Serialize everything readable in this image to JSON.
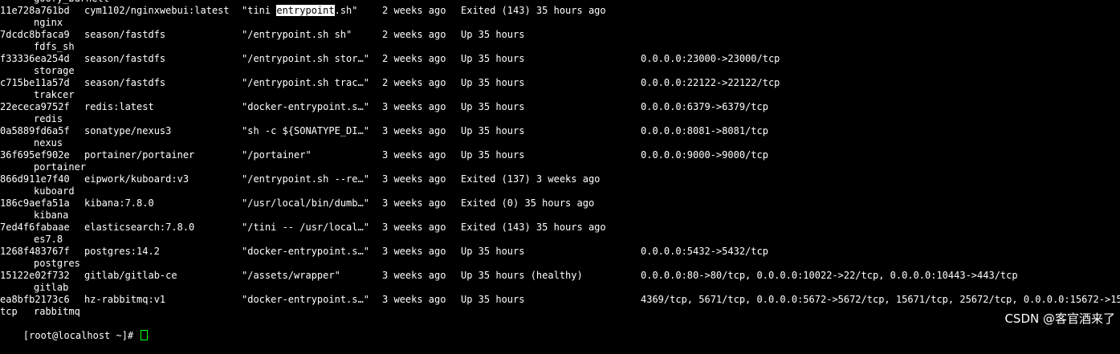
{
  "terminal": {
    "top_name": "goofy_burnett",
    "rows": [
      {
        "id": "11e728a761bd",
        "image": "cym1102/nginxwebui:latest",
        "cmd_before": "\"tini ",
        "cmd_highlight": "entrypoint",
        "cmd_after": ".sh\"",
        "created": "2 weeks ago",
        "status": "Exited (143) 35 hours ago",
        "ports": "",
        "name": "nginx"
      },
      {
        "id": "7dcdc8bfaca9",
        "image": "season/fastdfs",
        "cmd": "\"/entrypoint.sh sh\"",
        "created": "2 weeks ago",
        "status": "Up 35 hours",
        "ports": "",
        "name": "fdfs_sh"
      },
      {
        "id": "f33336ea254d",
        "image": "season/fastdfs",
        "cmd": "\"/entrypoint.sh stor…\"",
        "created": "2 weeks ago",
        "status": "Up 35 hours",
        "ports": "0.0.0.0:23000->23000/tcp",
        "name": "storage"
      },
      {
        "id": "c715be11a57d",
        "image": "season/fastdfs",
        "cmd": "\"/entrypoint.sh trac…\"",
        "created": "2 weeks ago",
        "status": "Up 35 hours",
        "ports": "0.0.0.0:22122->22122/tcp",
        "name": "trakcer"
      },
      {
        "id": "22ececa9752f",
        "image": "redis:latest",
        "cmd": "\"docker-entrypoint.s…\"",
        "created": "3 weeks ago",
        "status": "Up 35 hours",
        "ports": "0.0.0.0:6379->6379/tcp",
        "name": "redis"
      },
      {
        "id": "0a5889fd6a5f",
        "image": "sonatype/nexus3",
        "cmd": "\"sh -c ${SONATYPE_DI…\"",
        "created": "3 weeks ago",
        "status": "Up 35 hours",
        "ports": "0.0.0.0:8081->8081/tcp",
        "name": "nexus"
      },
      {
        "id": "36f695ef902e",
        "image": "portainer/portainer",
        "cmd": "\"/portainer\"",
        "created": "3 weeks ago",
        "status": "Up 35 hours",
        "ports": "0.0.0.0:9000->9000/tcp",
        "name": "portainer"
      },
      {
        "id": "866d911e7f40",
        "image": "eipwork/kuboard:v3",
        "cmd": "\"/entrypoint.sh --re…\"",
        "created": "3 weeks ago",
        "status": "Exited (137) 3 weeks ago",
        "ports": "",
        "name": "kuboard"
      },
      {
        "id": "186c9aefa51a",
        "image": "kibana:7.8.0",
        "cmd": "\"/usr/local/bin/dumb…\"",
        "created": "3 weeks ago",
        "status": "Exited (0) 35 hours ago",
        "ports": "",
        "name": "kibana"
      },
      {
        "id": "7ed4f6fabaae",
        "image": "elasticsearch:7.8.0",
        "cmd": "\"/tini -- /usr/local…\"",
        "created": "3 weeks ago",
        "status": "Exited (143) 35 hours ago",
        "ports": "",
        "name": "es7.8"
      },
      {
        "id": "1268f483767f",
        "image": "postgres:14.2",
        "cmd": "\"docker-entrypoint.s…\"",
        "created": "3 weeks ago",
        "status": "Up 35 hours",
        "ports": "0.0.0.0:5432->5432/tcp",
        "name": "postgres"
      },
      {
        "id": "15122e02f732",
        "image": "gitlab/gitlab-ce",
        "cmd": "\"/assets/wrapper\"",
        "created": "3 weeks ago",
        "status": "Up 35 hours (healthy)",
        "ports": "0.0.0.0:80->80/tcp, 0.0.0.0:10022->22/tcp, 0.0.0.0:10443->443/tcp",
        "name": "gitlab"
      },
      {
        "id": "ea8bfb2173c6",
        "image": "hz-rabbitmq:v1",
        "cmd": "\"docker-entrypoint.s…\"",
        "created": "3 weeks ago",
        "status": "Up 35 hours",
        "ports": "4369/tcp, 5671/tcp, 0.0.0.0:5672->5672/tcp, 15671/tcp, 25672/tcp, 0.0.0.0:15672->15672/",
        "name_prefix": "tcp",
        "name": "rabbitmq"
      }
    ],
    "prompt": "[root@localhost ~]# "
  },
  "watermark": "CSDN @客官酒来了",
  "colors": {
    "background": "#000000",
    "foreground": "#ffffff",
    "highlight_bg": "#ffffff",
    "highlight_fg": "#000000",
    "cursor": "#00ff00"
  }
}
